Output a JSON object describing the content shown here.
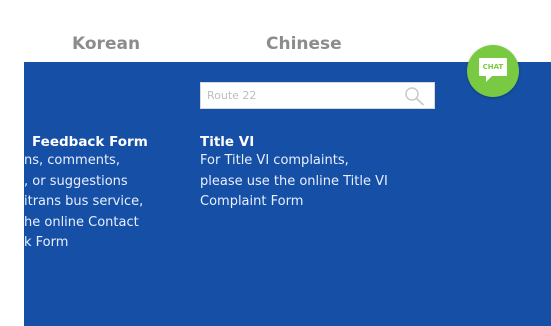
{
  "language_bar": {
    "korean": "Korean",
    "chinese": "Chinese"
  },
  "search": {
    "placeholder": "Route 22",
    "icon": "search-icon"
  },
  "feedback": {
    "title": "Feedback Form",
    "lines": [
      "ns, comments,",
      ", or suggestions",
      "itrans bus service,",
      "he online Contact",
      "k Form"
    ]
  },
  "title_vi": {
    "title": "Title VI",
    "lines": [
      "For Title VI complaints,",
      "please use the online Title VI",
      "Complaint Form"
    ]
  },
  "chat": {
    "label": "CHAT",
    "color": "#7ac943"
  },
  "colors": {
    "panel": "#1650a6",
    "chat_green": "#7ac943",
    "lang_text": "#8c8c8c"
  }
}
